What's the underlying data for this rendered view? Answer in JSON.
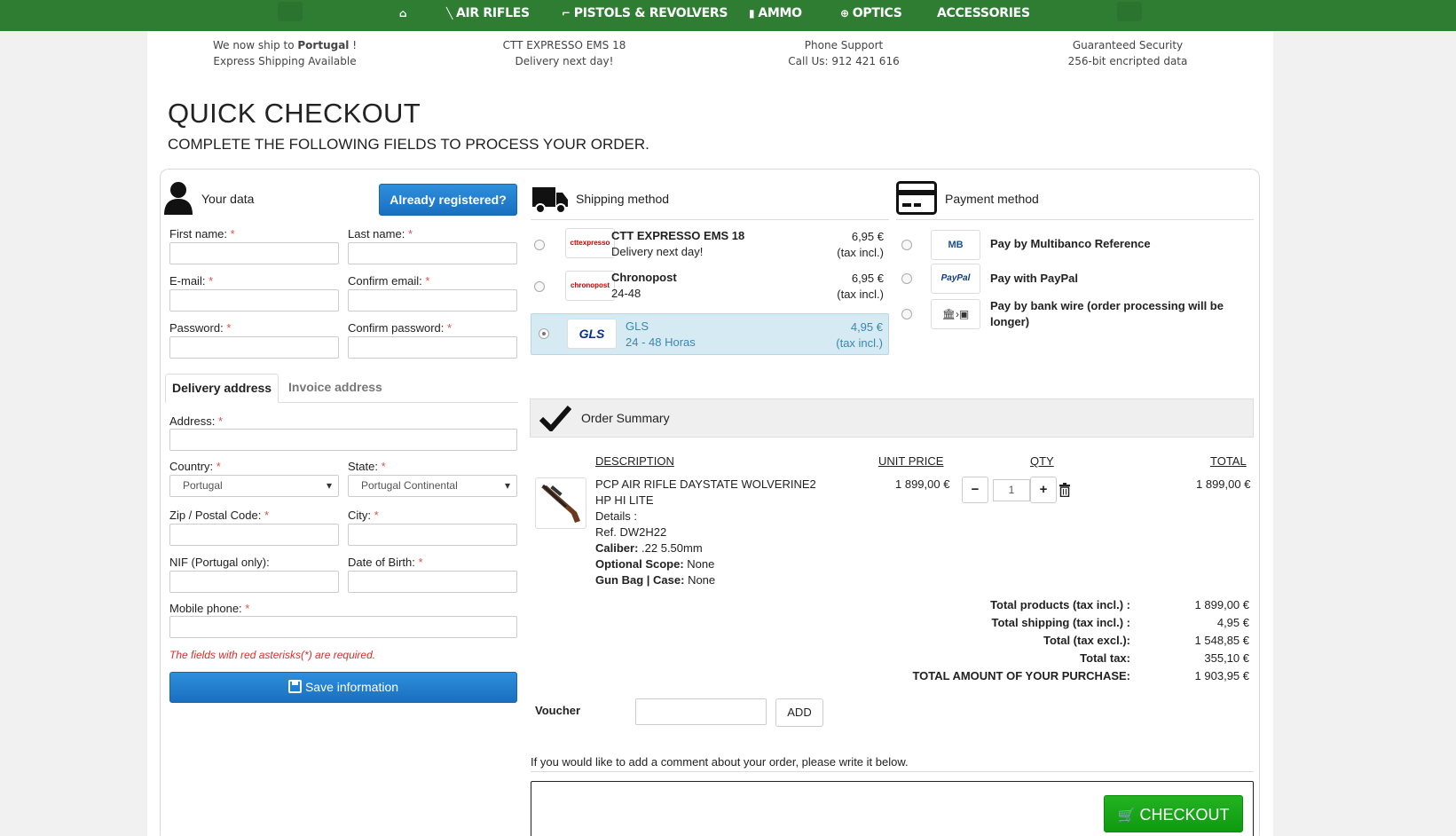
{
  "nav": {
    "items": [
      {
        "icon": "⌂",
        "label": ""
      },
      {
        "icon": "╲",
        "label": "AIR RIFLES"
      },
      {
        "icon": "⌐",
        "label": "PISTOLS & REVOLVERS"
      },
      {
        "icon": "▮",
        "label": "AMMO"
      },
      {
        "icon": "⊕",
        "label": "OPTICS"
      },
      {
        "icon": "",
        "label": "ACCESSORIES"
      }
    ]
  },
  "info": [
    {
      "line1_pre": "We now ship to ",
      "line1_bold": "Portugal",
      "line1_post": " !",
      "line2": "Express Shipping Available"
    },
    {
      "line1": "CTT EXPRESSO EMS 18",
      "line2": "Delivery next day!"
    },
    {
      "line1": "Phone Support",
      "line2": "Call Us: 912 421 616"
    },
    {
      "line1": "Guaranteed Security",
      "line2": "256-bit encripted data"
    }
  ],
  "page": {
    "title": "QUICK CHECKOUT",
    "subtitle": "COMPLETE THE FOLLOWING FIELDS TO PROCESS YOUR ORDER."
  },
  "your_data": {
    "heading": "Your data",
    "registered_button": "Already registered?",
    "fields": {
      "first_name": "First name:",
      "last_name": "Last name:",
      "email": "E-mail:",
      "confirm_email": "Confirm email:",
      "password": "Password:",
      "confirm_password": "Confirm password:",
      "address": "Address:",
      "country": "Country:",
      "state": "State:",
      "zip": "Zip / Postal Code:",
      "city": "City:",
      "nif": "NIF (Portugal only):",
      "dob": "Date of Birth:",
      "mobile": "Mobile phone:"
    },
    "required_mark": "*",
    "country_value": "Portugal",
    "state_value": "Portugal Continental",
    "tabs": [
      "Delivery address",
      "Invoice address"
    ],
    "required_note": "The fields with red asterisks(*) are required.",
    "save_button": "Save information"
  },
  "shipping": {
    "heading": "Shipping method",
    "options": [
      {
        "name": "CTT EXPRESSO EMS 18",
        "sub": "Delivery next day!",
        "price": "6,95 €",
        "tax": "(tax incl.)",
        "logo": "cttexpresso",
        "selected": false
      },
      {
        "name": "Chronopost",
        "sub": "24-48",
        "price": "6,95 €",
        "tax": "(tax incl.)",
        "logo": "chronopost",
        "selected": false
      },
      {
        "name": "GLS",
        "sub": "24 - 48 Horas",
        "price": "4,95 €",
        "tax": "(tax incl.)",
        "logo": "GLS",
        "selected": true
      }
    ]
  },
  "payment": {
    "heading": "Payment method",
    "options": [
      {
        "name": "Pay by Multibanco Reference",
        "logo": "MB"
      },
      {
        "name": "Pay with PayPal",
        "logo": "PayPal"
      },
      {
        "name": "Pay by bank wire (order processing will be longer)",
        "logo": "bank"
      }
    ]
  },
  "summary": {
    "heading": "Order Summary",
    "columns": {
      "description": "DESCRIPTION",
      "unit_price": "UNIT PRICE",
      "qty": "QTY",
      "total": "TOTAL"
    },
    "item": {
      "name_line1": "PCP AIR RIFLE DAYSTATE WOLVERINE2",
      "name_line2": "HP HI LITE",
      "details": "Details :",
      "ref": "Ref. DW2H22",
      "caliber_label": "Caliber:",
      "caliber": ".22 5.50mm",
      "scope_label": "Optional Scope:",
      "scope": "None",
      "bag_label": "Gun Bag | Case:",
      "bag": "None",
      "unit_price": "1 899,00 €",
      "qty": "1",
      "total": "1 899,00 €"
    },
    "totals": [
      {
        "label": "Total products  (tax incl.) :",
        "value": "1 899,00 €"
      },
      {
        "label": "Total shipping  (tax incl.) :",
        "value": "4,95 €"
      },
      {
        "label": "Total  (tax excl.):",
        "value": "1 548,85 €"
      },
      {
        "label": "Total tax:",
        "value": "355,10 €"
      },
      {
        "label": "TOTAL AMOUNT OF YOUR PURCHASE:",
        "value": "1 903,95 €"
      }
    ],
    "voucher_label": "Voucher",
    "voucher_button": "ADD",
    "comment_label": "If you would like to add a comment about your order, please write it below.",
    "checkout_button": "CHECKOUT"
  }
}
